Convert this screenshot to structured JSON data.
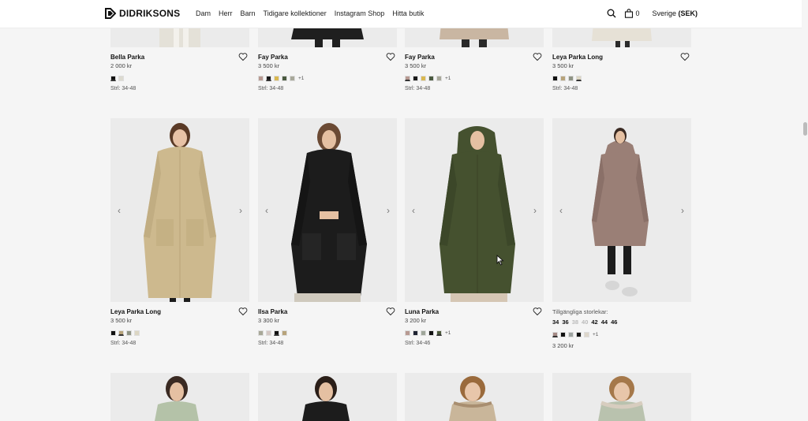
{
  "header": {
    "brand": "DIDRIKSONS",
    "nav": [
      "Dam",
      "Herr",
      "Barn",
      "Tidigare kollektioner",
      "Instagram Shop",
      "Hitta butik"
    ],
    "cart_count": "0",
    "region_label": "Sverige",
    "region_currency": "(SEK)"
  },
  "rows": [
    [
      {
        "name": "Bella Parka",
        "price": "2 000 kr",
        "sizes": "Strl: 34-48",
        "swatches": [
          "#111111",
          "#dcdad0"
        ],
        "more": ""
      },
      {
        "name": "Fay Parka",
        "price": "3 500 kr",
        "sizes": "Strl: 34-48",
        "swatches": [
          "#b89a92",
          "#1a1a1a",
          "#d9b850",
          "#4a5a40",
          "#a8a89a"
        ],
        "more": "+1"
      },
      {
        "name": "Fay Parka",
        "price": "3 500 kr",
        "sizes": "Strl: 34-48",
        "swatches": [
          "#b89a92",
          "#1a1a1a",
          "#d9b850",
          "#4a5a40",
          "#a8a89a"
        ],
        "more": "+1"
      },
      {
        "name": "Leya Parka Long",
        "price": "3 500 kr",
        "sizes": "Strl: 34-48",
        "swatches": [
          "#111111",
          "#b7a37b",
          "#8f9485",
          "#dcd6c3"
        ],
        "more": ""
      }
    ],
    [
      {
        "name": "Leya Parka Long",
        "price": "3 500 kr",
        "sizes": "Strl: 34-48",
        "swatches": [
          "#111111",
          "#b7a37b",
          "#8f9485",
          "#dcd6c3"
        ],
        "more": ""
      },
      {
        "name": "Ilsa Parka",
        "price": "3 300 kr",
        "sizes": "Strl: 34-48",
        "swatches": [
          "#a8a898",
          "#d4c8c4",
          "#111111",
          "#b7a37b"
        ],
        "more": ""
      },
      {
        "name": "Luna Parka",
        "price": "3 200 kr",
        "sizes": "Strl: 34-46",
        "swatches": [
          "#b89a92",
          "#1f2433",
          "#9fa69a",
          "#111111",
          "#4d5a3c"
        ],
        "more": "+1"
      },
      {
        "name": "",
        "price": "3 200 kr",
        "sizes": "",
        "swatches": [
          "#a58a85",
          "#111111",
          "#9da3a0",
          "#111111",
          "#ddd6cb"
        ],
        "more": "+1",
        "available_label": "Tillgängliga storlekar:",
        "available_sizes": [
          "34",
          "36",
          "38",
          "40",
          "42",
          "44",
          "46"
        ],
        "unavailable_sizes": [
          "38",
          "40"
        ]
      }
    ]
  ],
  "colors": {
    "beige_coat": "#cdb98e",
    "black_coat": "#1c1c1c",
    "green_coat": "#45512f",
    "mauve_coat": "#9a7f76",
    "sage_coat": "#b4c2a8",
    "fur": "#c9b69a"
  }
}
